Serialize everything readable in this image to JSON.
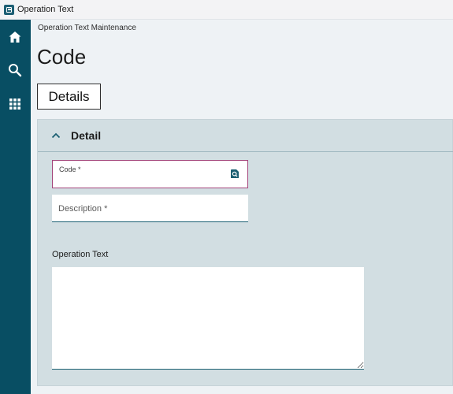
{
  "window": {
    "title": "Operation Text"
  },
  "sidebar": {
    "icons": [
      "home-icon",
      "search-icon",
      "apps-grid-icon"
    ]
  },
  "page": {
    "breadcrumb": "Operation Text Maintenance",
    "title": "Code"
  },
  "tabs": [
    {
      "label": "Details"
    }
  ],
  "section": {
    "title": "Detail",
    "expanded": true
  },
  "form": {
    "code": {
      "label": "Code *",
      "value": ""
    },
    "description": {
      "placeholder": "Description *",
      "value": ""
    },
    "operation_text": {
      "label": "Operation Text",
      "value": ""
    }
  },
  "colors": {
    "sidebar": "#084e63",
    "section_bg": "#d2dee2",
    "required_border": "#a3447a",
    "accent": "#1b5f72"
  }
}
